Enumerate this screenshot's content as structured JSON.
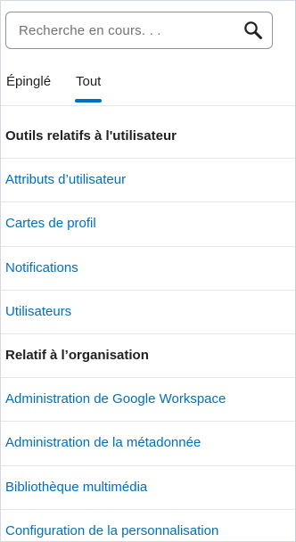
{
  "search": {
    "placeholder": "Recherche en cours. . ."
  },
  "tabs": [
    {
      "label": "Épinglé",
      "selected": false
    },
    {
      "label": "Tout",
      "selected": true
    }
  ],
  "colors": {
    "accent": "#006fbf",
    "text": "#202122",
    "divider": "#e3e6ea"
  },
  "sections": [
    {
      "title": "Outils relatifs à l'utilisateur",
      "items": [
        "Attributs d’utilisateur",
        "Cartes de profil",
        "Notifications",
        "Utilisateurs"
      ]
    },
    {
      "title": "Relatif à l’organisation",
      "items": [
        "Administration de Google Workspace",
        "Administration de la métadonnée",
        "Bibliothèque multimédia",
        "Configuration de la personnalisation"
      ]
    }
  ]
}
